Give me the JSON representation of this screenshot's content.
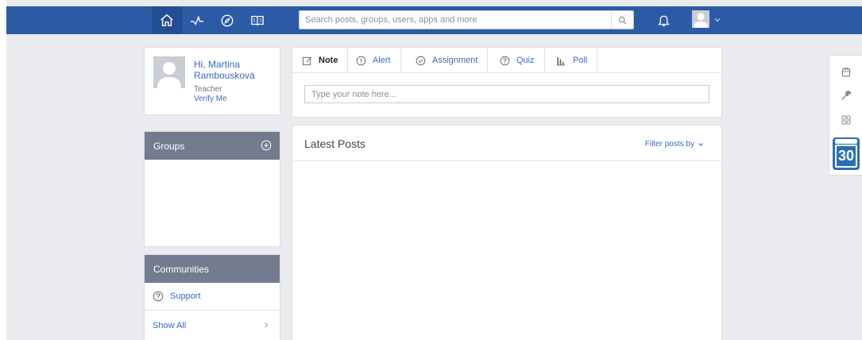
{
  "topbar": {
    "nav": [
      {
        "name": "home",
        "icon": "home-icon"
      },
      {
        "name": "activity",
        "icon": "activity-icon"
      },
      {
        "name": "discover",
        "icon": "compass-icon"
      },
      {
        "name": "backpack",
        "icon": "book-icon"
      }
    ],
    "search_placeholder": "Search posts, groups, users, apps and more",
    "colors": {
      "bar": "#2c5ba6",
      "active": "#244e93"
    }
  },
  "profile": {
    "greeting": "Hi, Martina Rambousková",
    "role": "Teacher",
    "verify_label": "Verify Me"
  },
  "groups": {
    "title": "Groups"
  },
  "communities": {
    "title": "Communities",
    "items": [
      {
        "label": "Support",
        "icon": "question-circle-icon"
      }
    ],
    "show_all_label": "Show All"
  },
  "composer": {
    "tabs": [
      {
        "label": "Note",
        "icon": "note-icon",
        "active": true
      },
      {
        "label": "Alert",
        "icon": "alert-icon",
        "active": false
      },
      {
        "label": "Assignment",
        "icon": "check-circle-icon",
        "active": false
      },
      {
        "label": "Quiz",
        "icon": "question-circle-icon",
        "active": false
      },
      {
        "label": "Poll",
        "icon": "bar-chart-icon",
        "active": false
      }
    ],
    "input_placeholder": "Type your note here..."
  },
  "posts": {
    "title": "Latest Posts",
    "filter_label": "Filter posts by"
  },
  "right_toolbar": {
    "items": [
      "backpack-icon",
      "wrench-icon",
      "apps-grid-icon"
    ],
    "calendar_day": "30"
  }
}
